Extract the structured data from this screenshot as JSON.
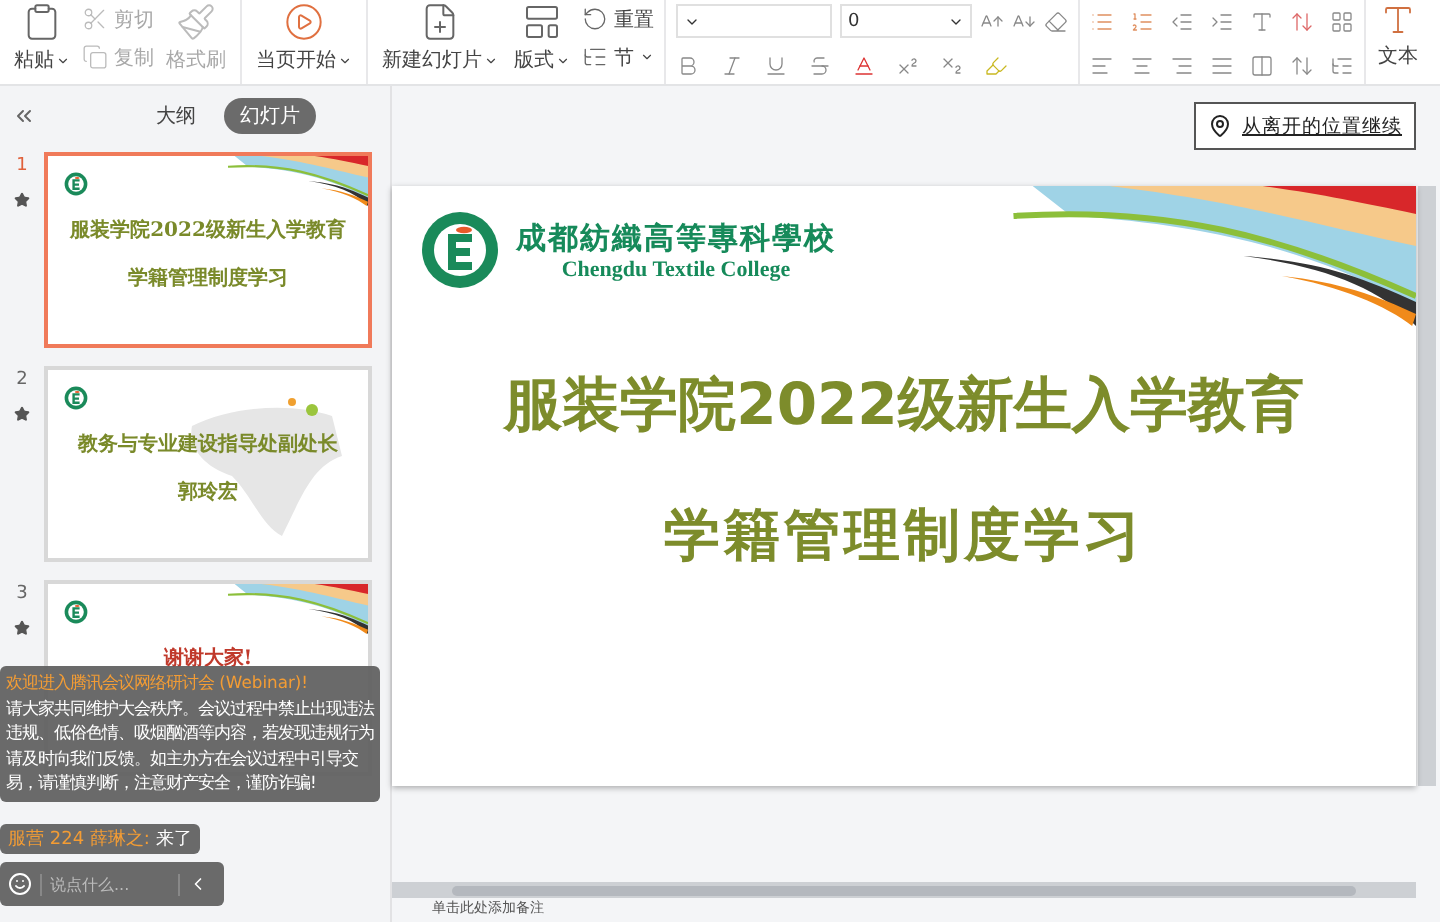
{
  "ribbon": {
    "buttons": [
      {
        "label": "粘贴",
        "kind": "large",
        "caret": true,
        "disabled": false
      },
      {
        "label": "剪切",
        "kind": "small",
        "caret": false,
        "disabled": true
      },
      {
        "label": "复制",
        "kind": "small",
        "caret": false,
        "disabled": true
      },
      {
        "label": "格式刷",
        "kind": "large",
        "caret": false,
        "disabled": true
      },
      {
        "label": "当页开始",
        "kind": "large",
        "caret": true,
        "disabled": false
      },
      {
        "label": "新建幻灯片",
        "kind": "large",
        "caret": true,
        "disabled": false
      },
      {
        "label": "版式",
        "kind": "large",
        "caret": true,
        "disabled": false
      },
      {
        "label": "重置",
        "kind": "small",
        "caret": false,
        "disabled": false
      },
      {
        "label": "节",
        "kind": "small",
        "caret": true,
        "disabled": false
      }
    ],
    "font_size": "0",
    "text_tool": "文本"
  },
  "view_tabs": [
    {
      "label": "大纲",
      "selected": false
    },
    {
      "label": "幻灯片",
      "selected": true
    }
  ],
  "slides": [
    {
      "number": "1",
      "selected": true,
      "kind": "ribbon",
      "title": "服装学院2022级新生入学教育",
      "subtitle": "学籍管理制度学习"
    },
    {
      "number": "2",
      "selected": false,
      "kind": "map",
      "title": "教务与专业建设指导处副处长",
      "subtitle": "郭玲宏"
    },
    {
      "number": "3",
      "selected": false,
      "kind": "ribbon",
      "title": "谢谢大家!"
    }
  ],
  "chat": {
    "notice_title": "欢迎进入腾讯会议网络研讨会 (Webinar)!",
    "notice_body": "请大家共同维护大会秩序。会议过程中禁止出现违法违规、低俗色情、吸烟酗酒等内容，若发现违规行为请及时向我们反馈。如主办方在会议过程中引导交易，请谨慎判断，注意财产安全，谨防诈骗!",
    "message_sender": "服营 224 薛琳之:",
    "message_text": "来了",
    "input_placeholder": "说点什么..."
  },
  "resume_button": "从离开的位置继续",
  "current_slide": {
    "school_name": "成都紡織高等專科學校",
    "school_name_en": "Chengdu Textile College",
    "title": "服装学院2022级新生入学教育",
    "subtitle": "学籍管理制度学习"
  },
  "notes_placeholder": "单击此处添加备注"
}
